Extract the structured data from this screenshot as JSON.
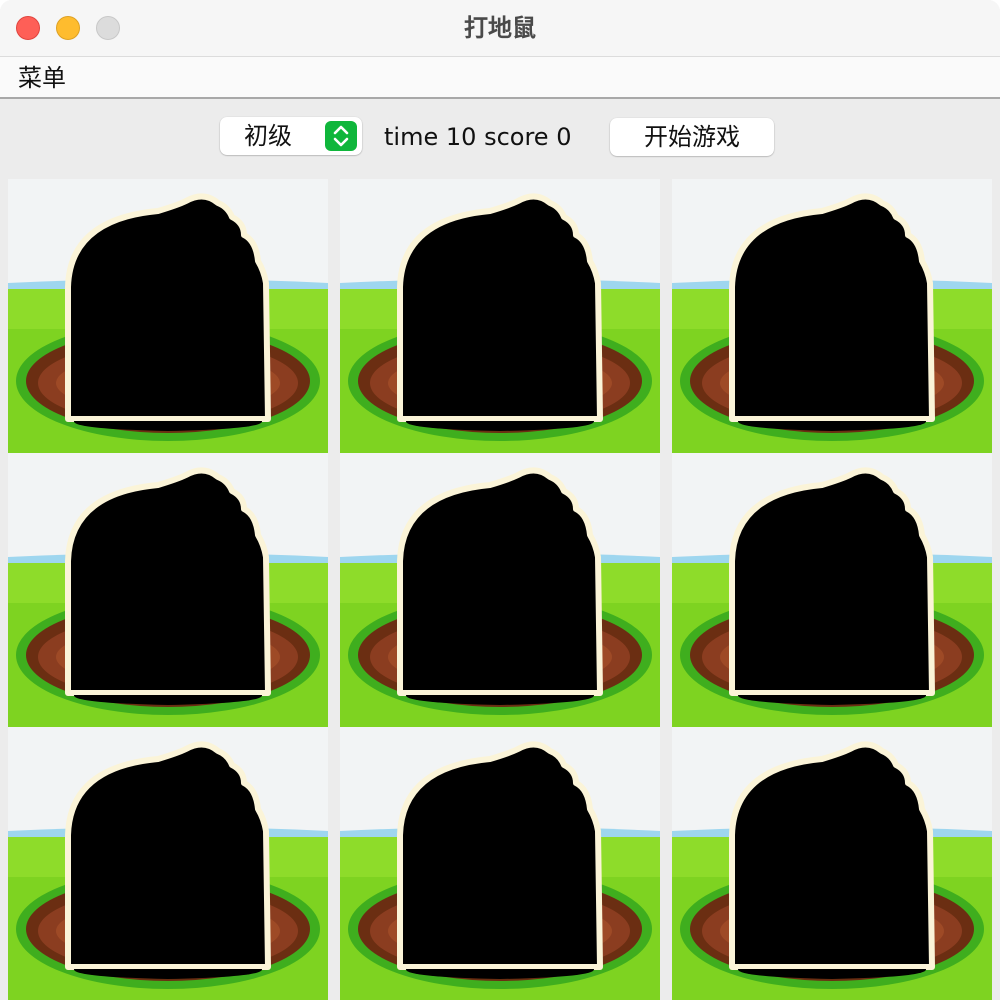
{
  "window": {
    "title": "打地鼠"
  },
  "menubar": {
    "items": [
      "菜单"
    ]
  },
  "controls": {
    "difficulty_selected": "初级",
    "time_label": "time",
    "time_value": "10",
    "score_label": "score",
    "score_value": "0",
    "start_label": "开始游戏"
  },
  "grid": {
    "rows": 3,
    "cols": 3,
    "cell_icon": "mole-hole-icon"
  },
  "colors": {
    "close": "#fe5f57",
    "minimize": "#febc2e",
    "zoom": "#dcdcdc",
    "select_accent": "#0fb63b",
    "grass": "#7ed321",
    "soil": "#8b3d20"
  }
}
